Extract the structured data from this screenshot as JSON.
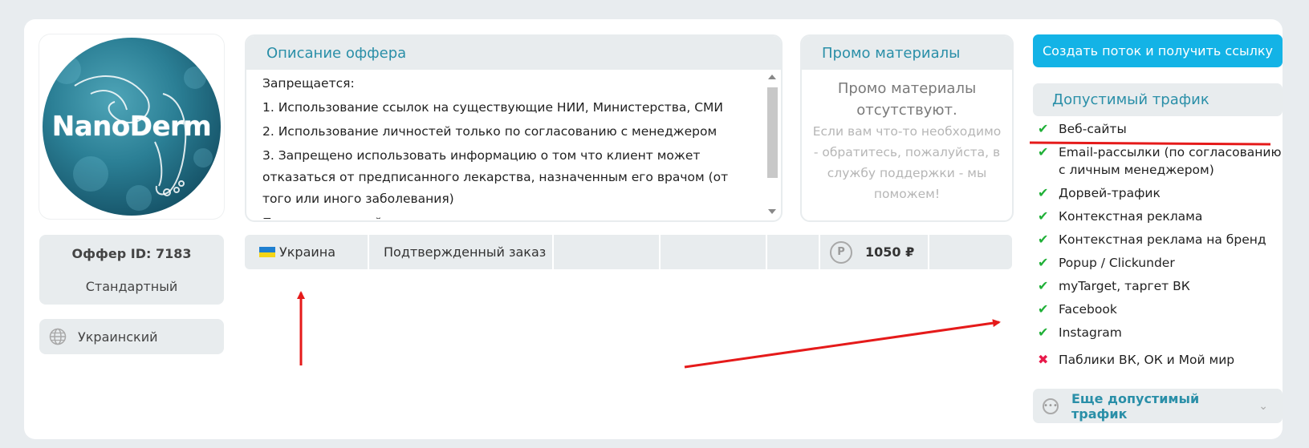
{
  "logo": {
    "text": "NanoDerm"
  },
  "offer": {
    "id_label": "Оффер ID: 7183",
    "type": "Стандартный",
    "language": "Украинский"
  },
  "description": {
    "title": "Описание оффера",
    "lines": [
      "Запрещается:",
      "1. Использование ссылок на существующие НИИ, Министерства, СМИ",
      "2. Использование личностей только по согласованию с менеджером",
      "3. Запрещено использовать информацию о том что клиент может отказаться от предписанного лекарства, назначенным его врачом (от того или иного заболевания)",
      "Предоставленный продукт не является лекарственным средством и не требует"
    ]
  },
  "promo": {
    "title": "Промо материалы",
    "main": "Промо материалы отсутствуют.",
    "sub": "Если вам что-то необходимо - обратитесь, пожалуйста, в службу поддержки - мы поможем!"
  },
  "geo_row": {
    "country": "Украина",
    "action": "Подтвержденный заказ",
    "coin_symbol": "Р",
    "price": "1050 ₽"
  },
  "actions": {
    "create_flow": "Создать поток и получить ссылку"
  },
  "traffic": {
    "title": "Допустимый трафик",
    "allowed": [
      "Веб-сайты",
      "Email-рассылки (по согласованию с личным менеджером)",
      "Дорвей-трафик",
      "Контекстная реклама",
      "Контекстная реклама на бренд",
      "Popup / Clickunder",
      "myTarget, таргет ВК",
      "Facebook",
      "Instagram"
    ],
    "denied": [
      "Паблики ВК, ОК и Мой мир"
    ],
    "more_label": "Еще допустимый трафик"
  },
  "colors": {
    "accent": "#2a8fa8",
    "button": "#13b3e6",
    "allowed": "#20b038",
    "denied": "#e8194a",
    "annotation": "#e51a1a"
  }
}
